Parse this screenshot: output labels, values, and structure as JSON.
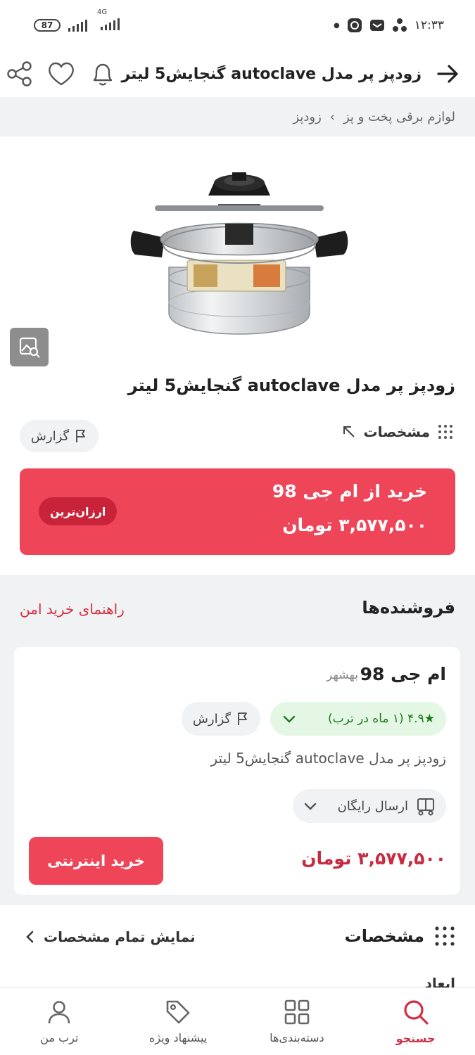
{
  "status_bar": {
    "time": "۱۲:۳۳",
    "battery": "87",
    "network": "4G"
  },
  "header": {
    "title": "زودپز پر مدل autoclave گنجایش5 لیتر",
    "back_icon": "arrow-right-icon",
    "icons": [
      "bell-icon",
      "heart-icon",
      "share-icon"
    ]
  },
  "breadcrumb": {
    "items": [
      "لوازم برقی پخت و پز",
      "زودپز"
    ],
    "separator": "›"
  },
  "product": {
    "title": "زودپز پر مدل autoclave گنجایش5 لیتر",
    "specs_link": "مشخصات",
    "report_label": "گزارش"
  },
  "buy_banner": {
    "line1": "خرید از ام جی 98",
    "price": "۳,۵۷۷,۵۰۰ تومان",
    "badge": "ارزان‌ترین",
    "color": "#ee4559"
  },
  "sellers": {
    "heading": "فروشنده‌ها",
    "guide_link": "راهنمای خرید امن",
    "card": {
      "name": "ام جی 98",
      "city": "بهشهر",
      "rating": "★۴.۹ (۱ ماه در ترب)",
      "report_label": "گزارش",
      "offer_title": "زودپز پر مدل autoclave گنجایش5 لیتر",
      "shipping": "ارسال رایگان",
      "price": "۳,۵۷۷,۵۰۰ تومان",
      "buy_button": "خرید اینترنتی"
    }
  },
  "specs_section": {
    "heading": "مشخصات",
    "show_all": "نمایش تمام مشخصات",
    "first_row_peek": "ابعاد"
  },
  "bottom_nav": {
    "items": [
      {
        "label": "جستجو",
        "icon": "search-icon",
        "active": true
      },
      {
        "label": "دسته‌بندی‌ها",
        "icon": "grid-icon",
        "active": false
      },
      {
        "label": "پیشنهاد ویژه",
        "icon": "tag-icon",
        "active": false
      },
      {
        "label": "ترب من",
        "icon": "user-icon",
        "active": false
      }
    ]
  }
}
